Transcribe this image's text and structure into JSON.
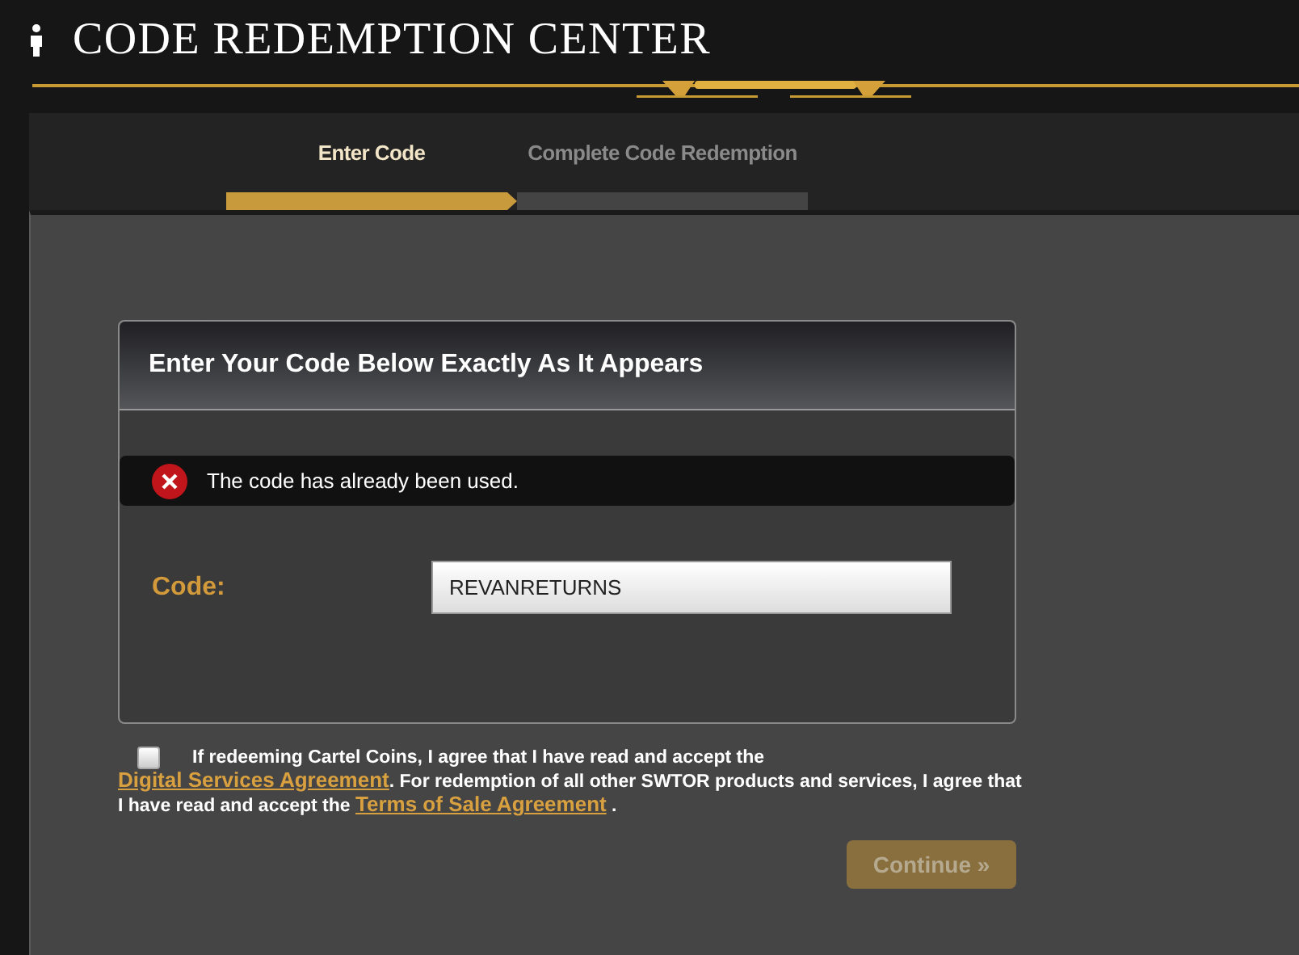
{
  "header": {
    "title": "CODE REDEMPTION CENTER"
  },
  "steps": [
    {
      "label": "Enter Code",
      "selected": true
    },
    {
      "label": "Complete Code Redemption",
      "selected": false
    }
  ],
  "card": {
    "title": "Enter Your Code Below Exactly As It Appears",
    "error": "The code has already been used.",
    "code_label": "Code:",
    "code_value": "REVANRETURNS"
  },
  "agreement": {
    "checked": false,
    "text_1": "If redeeming Cartel Coins, I agree that I have read and accept the",
    "link_1": "Digital Services Agreement",
    "text_2": ". For redemption of all other SWTOR products and services, I agree that I have read and accept the",
    "link_2": "Terms of Sale Agreement",
    "text_3": "."
  },
  "continue_button": {
    "label": "Continue »",
    "disabled": true
  }
}
